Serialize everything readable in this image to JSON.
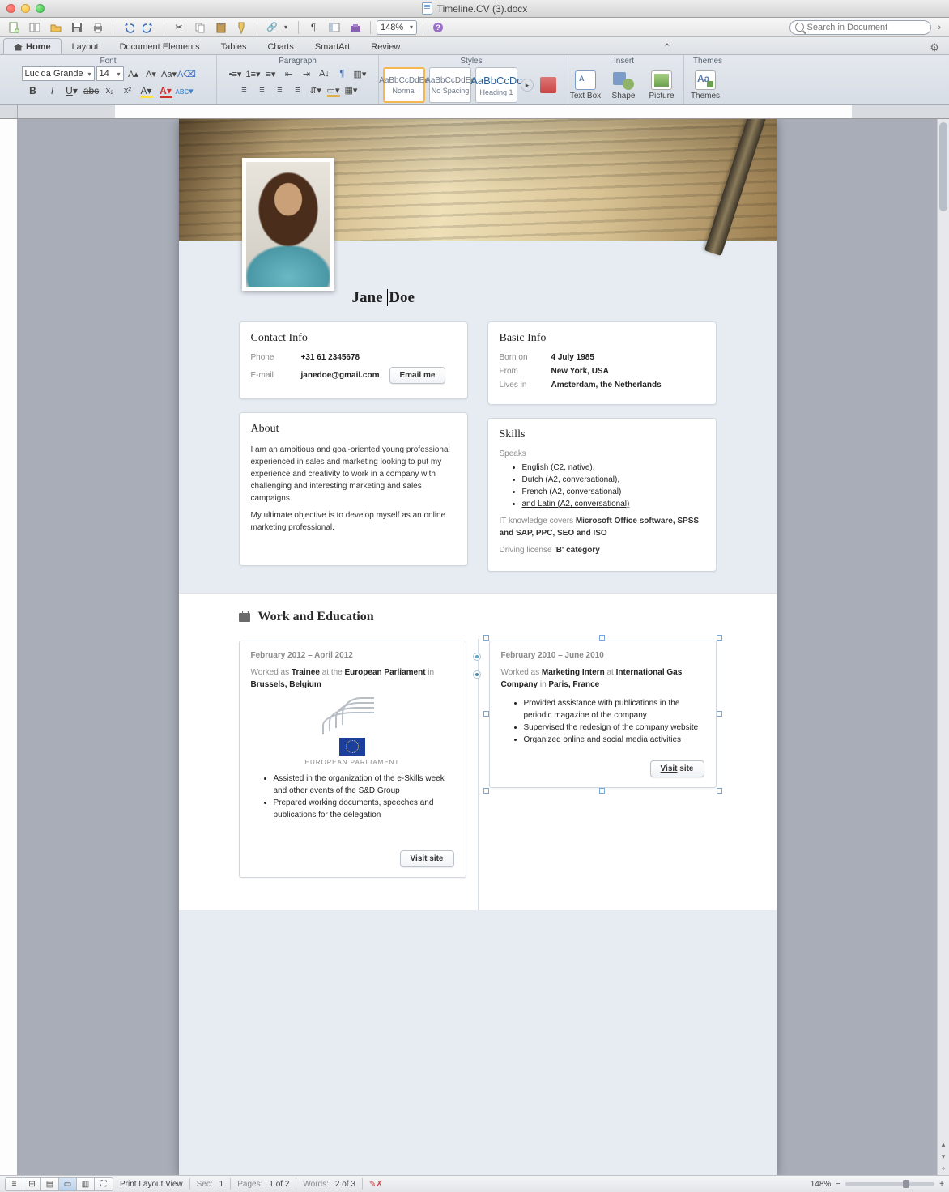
{
  "window": {
    "title": "Timeline.CV (3).docx"
  },
  "qat": {
    "zoom": "148%",
    "search_placeholder": "Search in Document"
  },
  "tabs": [
    "Home",
    "Layout",
    "Document Elements",
    "Tables",
    "Charts",
    "SmartArt",
    "Review"
  ],
  "ribbon": {
    "groups": {
      "font": "Font",
      "paragraph": "Paragraph",
      "styles": "Styles",
      "insert": "Insert",
      "themes": "Themes"
    },
    "font_name": "Lucida Grande",
    "font_size": "14",
    "styles": [
      {
        "preview": "AaBbCcDdEe",
        "label": "Normal",
        "selected": true
      },
      {
        "preview": "AaBbCcDdEe",
        "label": "No Spacing",
        "selected": false
      },
      {
        "preview": "AaBbCcDc",
        "label": "Heading 1",
        "selected": false
      }
    ],
    "insert_btns": {
      "textbox": "Text Box",
      "shape": "Shape",
      "picture": "Picture"
    },
    "themes_btn": "Themes"
  },
  "cv": {
    "name_first": "Jane ",
    "name_last": "Doe",
    "contact": {
      "title": "Contact Info",
      "phone_k": "Phone",
      "phone_v": "+31 61 2345678",
      "email_k": "E-mail",
      "email_v": "janedoe@gmail.com",
      "email_btn": "Email me"
    },
    "basic": {
      "title": "Basic Info",
      "born_k": "Born on",
      "born_v": "4 July 1985",
      "from_k": "From",
      "from_v": "New York, USA",
      "lives_k": "Lives in",
      "lives_v": "Amsterdam, the Netherlands"
    },
    "about": {
      "title": "About",
      "p1": "I am an ambitious and goal-oriented young professional experienced in sales and marketing looking to put my experience and creativity to work in a company with challenging and interesting marketing and sales campaigns.",
      "p2": "My ultimate objective is to develop myself as an online marketing professional."
    },
    "skills": {
      "title": "Skills",
      "speaks": "Speaks",
      "langs": [
        "English (C2, native),",
        "Dutch (A2, conversational),",
        "French (A2, conversational)",
        "and Latin (A2, conversational)"
      ],
      "it_k": "IT knowledge covers",
      "it_v": "Microsoft Office software, SPSS and SAP, PPC, SEO and ISO",
      "dl_k": "Driving license",
      "dl_v": "'B' category"
    },
    "work": {
      "title": "Work and Education",
      "left": {
        "date": "February 2012 – April 2012",
        "worked": "Worked as ",
        "role": "Trainee",
        "at": " at the ",
        "org": "European Parliament",
        "in": " in ",
        "loc": "Brussels, Belgium",
        "logo": "EUROPEAN PARLIAMENT",
        "bullets": [
          "Assisted in the organization of the e-Skills week and other events of the S&D Group",
          "Prepared working documents, speeches and publications for the delegation"
        ],
        "visit": "Visit",
        "visit2": " site"
      },
      "right": {
        "date": "February 2010 – June 2010",
        "worked": "Worked as ",
        "role": "Marketing Intern",
        "at": " at ",
        "org": "International Gas Company",
        "in": " in ",
        "loc": "Paris, France",
        "bullets": [
          "Provided assistance with publications in the periodic magazine of the company",
          "Supervised the redesign of the company website",
          "Organized online and social media activities"
        ],
        "visit": "Visit",
        "visit2": " site"
      }
    }
  },
  "status": {
    "view": "Print Layout View",
    "sec_k": "Sec:",
    "sec_v": "1",
    "pages_k": "Pages:",
    "pages_v": "1 of 2",
    "words_k": "Words:",
    "words_v": "2 of 3",
    "zoom": "148%"
  }
}
